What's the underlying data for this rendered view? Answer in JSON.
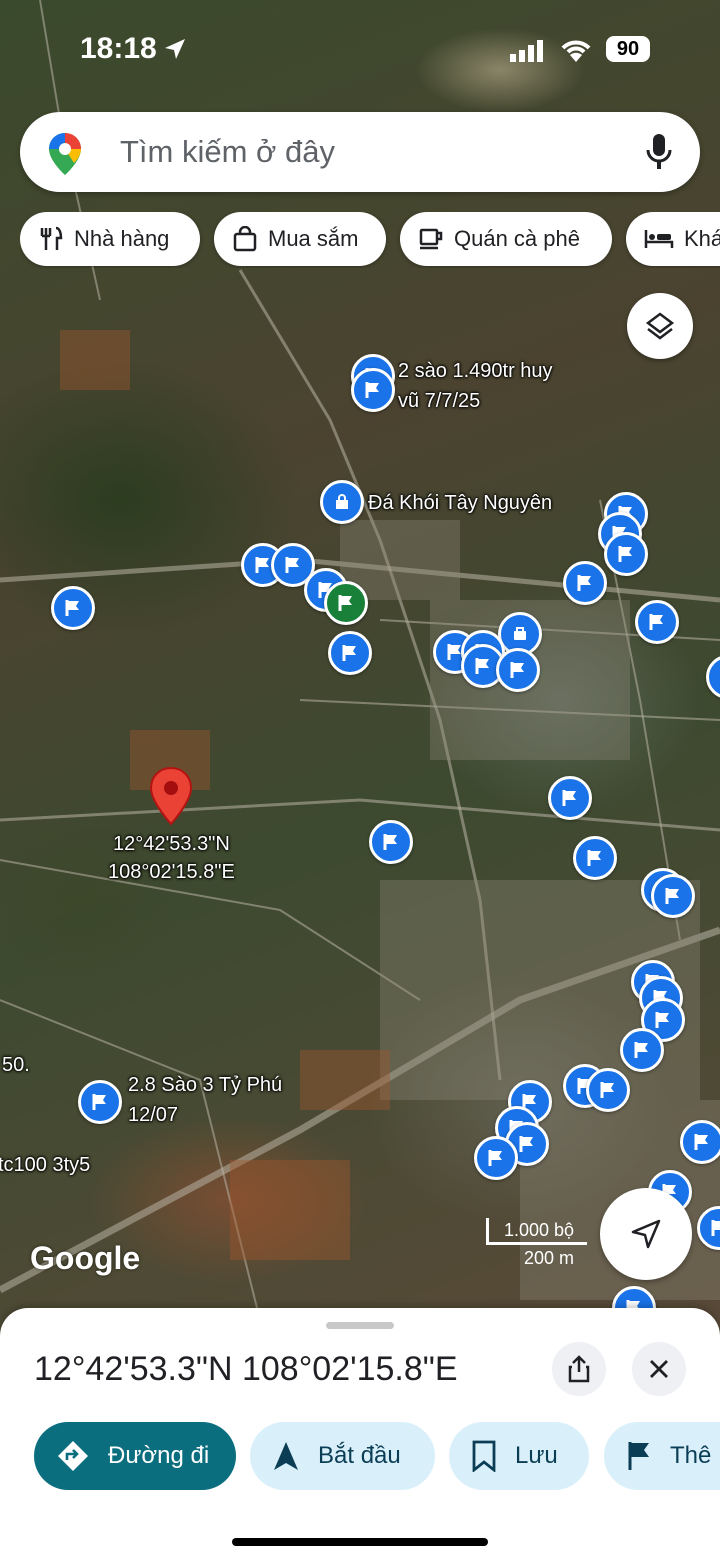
{
  "status_bar": {
    "time": "18:18",
    "battery": "90"
  },
  "search": {
    "placeholder": "Tìm kiếm ở đây"
  },
  "chips": [
    {
      "label": "Nhà hàng",
      "icon": "fork-knife-icon"
    },
    {
      "label": "Mua sắm",
      "icon": "shopping-bag-icon"
    },
    {
      "label": "Quán cà phê",
      "icon": "coffee-cup-icon"
    },
    {
      "label": "Khá",
      "icon": "bed-icon"
    }
  ],
  "map": {
    "labels": {
      "listing_1_line1": "2 sào 1.490tr huy",
      "listing_1_line2": "vũ 7/7/25",
      "landmark": "Đá Khói Tây Nguyên",
      "pin_line1": "12°42'53.3\"N",
      "pin_line2": "108°02'15.8\"E",
      "listing_2_line1": "2.8 Sào 3 Tỷ Phú",
      "listing_2_line2": "12/07",
      "left_fragment_1": "50.",
      "left_fragment_2": "tc100 3ty5"
    },
    "logo": "Google",
    "scale": {
      "imperial": "1.000 bộ",
      "metric": "200 m"
    }
  },
  "place_sheet": {
    "title": "12°42'53.3\"N 108°02'15.8\"E",
    "actions": {
      "directions": "Đường đi",
      "start": "Bắt đầu",
      "save": "Lưu",
      "more": "Thê"
    }
  },
  "colors": {
    "accent": "#0b6e7f",
    "chip_bg": "#d9f0fb",
    "poi": "#1a73e8",
    "pin": "#ea4335"
  }
}
